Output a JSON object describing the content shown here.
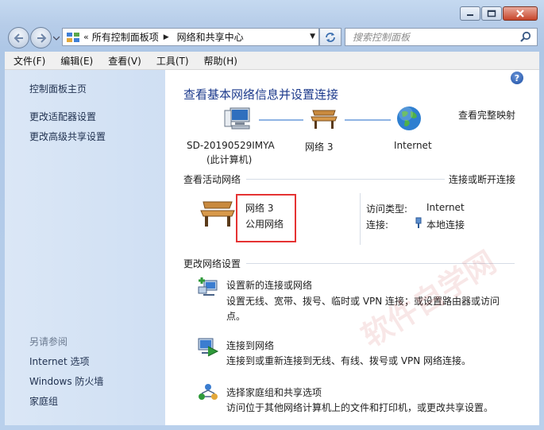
{
  "window": {
    "buttons": [
      "minimize",
      "maximize",
      "close"
    ]
  },
  "address_bar": {
    "overflow": "«",
    "crumbs": [
      "所有控制面板项",
      "网络和共享中心"
    ],
    "search_placeholder": "搜索控制面板"
  },
  "menu": {
    "items": [
      "文件(F)",
      "编辑(E)",
      "查看(V)",
      "工具(T)",
      "帮助(H)"
    ]
  },
  "sidebar": {
    "links": [
      "控制面板主页",
      "更改适配器设置",
      "更改高级共享设置"
    ],
    "see_also_header": "另请参阅",
    "see_also": [
      "Internet 选项",
      "Windows 防火墙",
      "家庭组"
    ]
  },
  "main": {
    "title": "查看基本网络信息并设置连接",
    "full_map_link": "查看完整映射",
    "map": {
      "computer_name": "SD-20190529IMYA",
      "computer_sub": "(此计算机)",
      "network_name": "网络  3",
      "internet_label": "Internet"
    },
    "active_header": "查看活动网络",
    "connect_disconnect_link": "连接或断开连接",
    "active_network": {
      "name": "网络  3",
      "type_link": "公用网络",
      "access_type_label": "访问类型:",
      "access_type_value": "Internet",
      "connection_label": "连接:",
      "connection_link": "本地连接"
    },
    "change_header": "更改网络设置",
    "tasks": [
      {
        "title": "设置新的连接或网络",
        "desc": "设置无线、宽带、拨号、临时或 VPN 连接；或设置路由器或访问点。",
        "icon": "new-connection-icon"
      },
      {
        "title": "连接到网络",
        "desc": "连接到或重新连接到无线、有线、拨号或 VPN 网络连接。",
        "icon": "connect-network-icon"
      },
      {
        "title": "选择家庭组和共享选项",
        "desc": "访问位于其他网络计算机上的文件和打印机，或更改共享设置。",
        "icon": "homegroup-icon"
      }
    ]
  },
  "watermark": "软件自学网"
}
